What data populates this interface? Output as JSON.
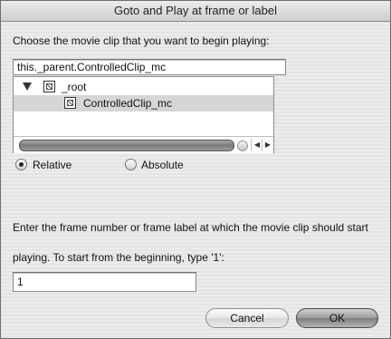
{
  "dialog": {
    "title": "Goto and Play at frame or label",
    "choose_label": "Choose the movie clip that you want to begin playing:",
    "target_path": "this._parent.ControlledClip_mc",
    "tree": {
      "root_label": "_root",
      "child_label": "ControlledClip_mc"
    },
    "path_mode": {
      "relative_label": "Relative",
      "absolute_label": "Absolute",
      "selected": "Relative"
    },
    "frame_instruction_line1": "Enter the frame number or frame label at which the movie clip should start",
    "frame_instruction_line2": "playing.  To start from the beginning, type '1':",
    "frame_value": "1",
    "cancel_label": "Cancel",
    "ok_label": "OK"
  }
}
